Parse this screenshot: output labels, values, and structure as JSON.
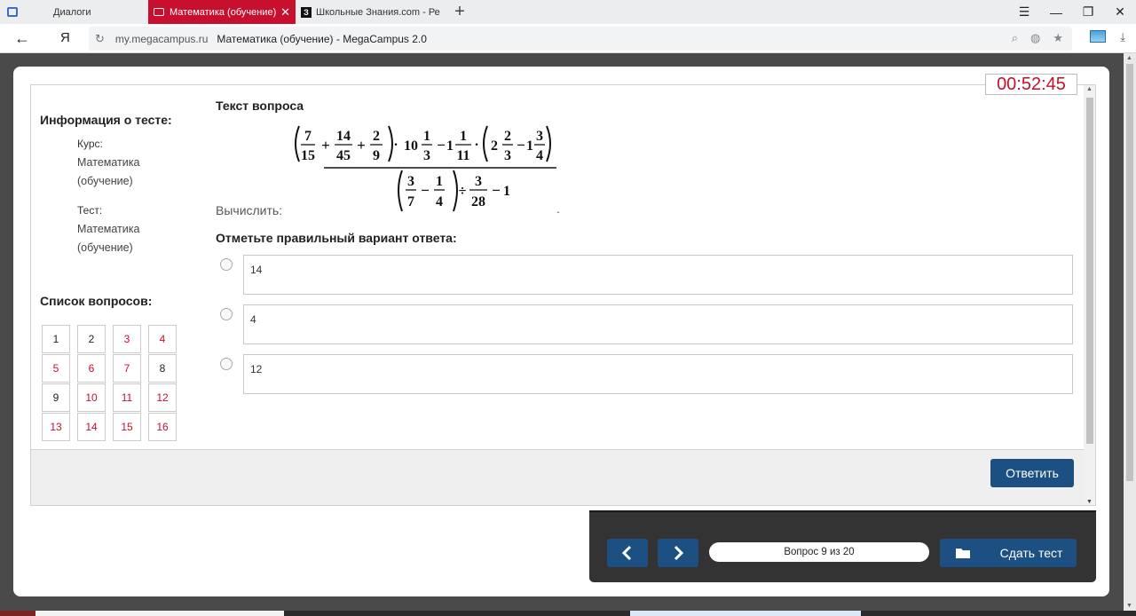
{
  "browser": {
    "tabs": [
      {
        "label": "Диалоги"
      },
      {
        "label": "Математика (обучение)"
      },
      {
        "label": "Школьные Знания.com - Ре"
      }
    ],
    "address": {
      "domain": "my.megacampus.ru",
      "page_title": "Математика (обучение) - MegaCampus 2.0"
    }
  },
  "timer": "00:52:45",
  "info": {
    "title": "Информация о тесте:",
    "course_label": "Курс:",
    "course_value": "Математика (обучение)",
    "test_label": "Тест:",
    "test_value": "Математика (обучение)"
  },
  "question_list": {
    "title": "Список вопросов:",
    "items": [
      {
        "n": "1",
        "answered": true
      },
      {
        "n": "2",
        "answered": true
      },
      {
        "n": "3",
        "answered": false
      },
      {
        "n": "4",
        "answered": false
      },
      {
        "n": "5",
        "answered": false
      },
      {
        "n": "6",
        "answered": false
      },
      {
        "n": "7",
        "answered": false
      },
      {
        "n": "8",
        "answered": true
      },
      {
        "n": "9",
        "answered": true
      },
      {
        "n": "10",
        "answered": false
      },
      {
        "n": "11",
        "answered": false
      },
      {
        "n": "12",
        "answered": false
      },
      {
        "n": "13",
        "answered": false
      },
      {
        "n": "14",
        "answered": false
      },
      {
        "n": "15",
        "answered": false
      },
      {
        "n": "16",
        "answered": false
      }
    ]
  },
  "question": {
    "heading": "Текст вопроса",
    "prompt": "Вычислить:",
    "trailing": ".",
    "answer_prompt": "Отметьте правильный вариант ответа:",
    "options": [
      "14",
      "4",
      "12"
    ]
  },
  "formula": {
    "f1_num": "7",
    "f1_den": "15",
    "f2_num": "14",
    "f2_den": "45",
    "f3_num": "2",
    "f3_den": "9",
    "m1_whole": "10",
    "m1_num": "1",
    "m1_den": "3",
    "m2_whole": "1",
    "m2_num": "1",
    "m2_den": "11",
    "m3_whole": "2",
    "m3_num": "2",
    "m3_den": "3",
    "m4_whole": "1",
    "m4_num": "3",
    "m4_den": "4",
    "d1_num": "3",
    "d1_den": "7",
    "d2_num": "1",
    "d2_den": "4",
    "d3_num": "3",
    "d3_den": "28",
    "d_tail": "1",
    "op_plus": "+",
    "op_minus": "−",
    "op_dot": "·",
    "op_div": "÷"
  },
  "actions": {
    "submit": "Ответить",
    "progress": "Вопрос 9 из 20",
    "finish": "Сдать тест"
  },
  "colors": {
    "accent_red": "#c8102e",
    "button_blue": "#1c4f82",
    "nav_panel": "#333333"
  }
}
